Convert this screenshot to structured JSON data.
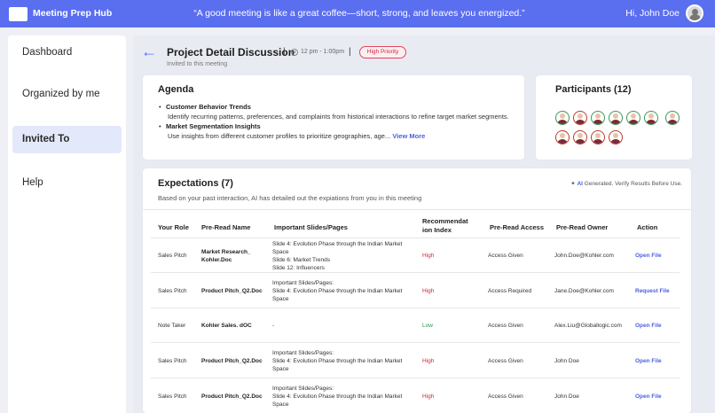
{
  "app": {
    "title": "Meeting Prep Hub",
    "quote": "“A good meeting is like a great coffee—short, strong, and leaves you energized.”",
    "greeting": "Hi, John Doe"
  },
  "sidebar": {
    "items": [
      {
        "label": "Dashboard"
      },
      {
        "label": "Organized by me"
      },
      {
        "label": "Invited To"
      },
      {
        "label": "Help"
      }
    ]
  },
  "header": {
    "title": "Project Detail Discussion",
    "time": "12 pm - 1:00pm",
    "priority": "High Priority",
    "subtitle": "Invited to this meeting"
  },
  "agenda": {
    "title": "Agenda",
    "items": [
      {
        "head": "Customer Behavior Trends",
        "desc": "Identify recurring patterns, preferences, and complaints from historical interactions to refine target market segments."
      },
      {
        "head": "Market Segmentation Insights",
        "desc": "Use insights from different customer profiles to prioritize geographies, age..."
      }
    ],
    "view_more": "View More"
  },
  "participants": {
    "title": "Participants (12)"
  },
  "expectations": {
    "title": "Expectations (7)",
    "ai_label": "AI",
    "ai_note": "Generated. Verify Results Before Use.",
    "subtitle": "Based on your past interaction, AI has detailed out the expiations from you in this meeting",
    "headers": [
      "Your Role",
      "Pre-Read Name",
      "Important Slides/Pages",
      "Recommendat ion Index",
      "Pre-Read Access",
      "Pre-Read Owner",
      "Action"
    ],
    "rows": [
      {
        "role": "Sales Pitch",
        "name": "Market Research_ Kohler.Doc",
        "slides": "Slide 4: Evolution Phase through the Indian Market Space\nSlide 6: Market Trends\nSlide 12: Influencers",
        "index": "High",
        "access": "Access Given",
        "owner": "John.Doe@Kohler.com",
        "action": "Open File"
      },
      {
        "role": "Sales Pitch",
        "name": "Product Pitch_Q2.Doc",
        "slides": "Important Slides/Pages:\nSlide 4: Evolution Phase through the Indian Market Space",
        "index": "High",
        "access": "Access Required",
        "owner": "Jane.Doe@Kohler.com",
        "action": "Request File"
      },
      {
        "role": "Note Taker",
        "name": "Kohler Sales. dOC",
        "slides": "-",
        "index": "Low",
        "access": "Access Given",
        "owner": "Alex.Liu@Globallogic.com",
        "action": "Open File"
      },
      {
        "role": "Sales Pitch",
        "name": "Product Pitch_Q2.Doc",
        "slides": "Important Slides/Pages:\nSlide 4: Evolution Phase through the Indian Market Space",
        "index": "High",
        "access": "Access Given",
        "owner": "John Doe",
        "action": "Open File"
      },
      {
        "role": "Sales Pitch",
        "name": "Product Pitch_Q2.Doc",
        "slides": "Important Slides/Pages:\nSlide 4: Evolution Phase through the Indian Market Space",
        "index": "High",
        "access": "Access Given",
        "owner": "John Doe",
        "action": "Open File"
      }
    ]
  },
  "colors": {
    "brand": "#5a6ef0",
    "high": "#d0243a",
    "low": "#1f9a4a",
    "link": "#4a5fe0"
  }
}
